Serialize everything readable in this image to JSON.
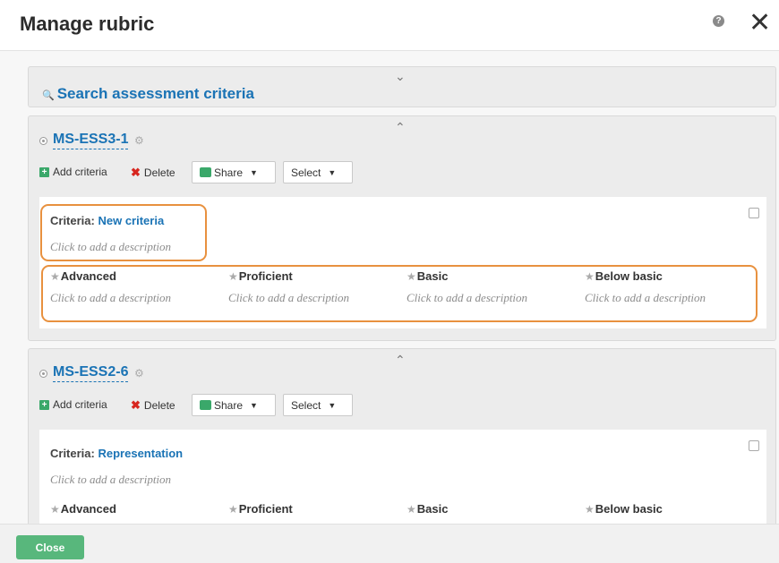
{
  "dialog": {
    "title": "Manage rubric",
    "help_icon": "?",
    "close_icon": "✕"
  },
  "search": {
    "label": "Search assessment criteria",
    "chevron": "﹀"
  },
  "standards": [
    {
      "code": "MS-ESS3-1",
      "toolbar": {
        "add": "Add criteria",
        "delete": "Delete",
        "share": "Share",
        "select": "Select"
      },
      "criteria": {
        "prefix": "Criteria:",
        "name": "New criteria",
        "description": "Click to add a description",
        "levels": [
          {
            "label": "Advanced",
            "description": "Click to add a description"
          },
          {
            "label": "Proficient",
            "description": "Click to add a description"
          },
          {
            "label": "Basic",
            "description": "Click to add a description"
          },
          {
            "label": "Below basic",
            "description": "Click to add a description"
          }
        ]
      }
    },
    {
      "code": "MS-ESS2-6",
      "toolbar": {
        "add": "Add criteria",
        "delete": "Delete",
        "share": "Share",
        "select": "Select"
      },
      "criteria": {
        "prefix": "Criteria:",
        "name": "Representation",
        "description": "Click to add a description",
        "levels": [
          {
            "label": "Advanced"
          },
          {
            "label": "Proficient"
          },
          {
            "label": "Basic"
          },
          {
            "label": "Below basic"
          }
        ]
      }
    }
  ],
  "footer": {
    "close_label": "Close"
  },
  "colors": {
    "link": "#1a73b5",
    "highlight": "#e8913f",
    "close_button": "#58b77c"
  }
}
